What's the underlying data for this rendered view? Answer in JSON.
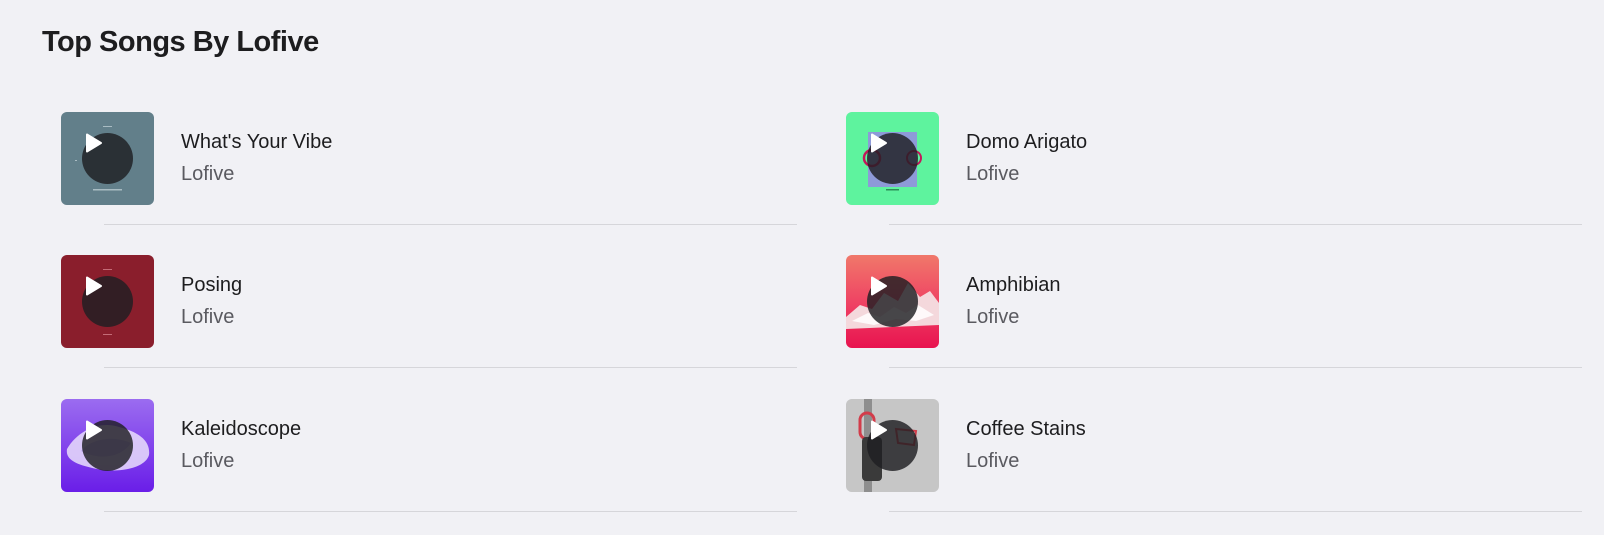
{
  "section": {
    "title": "Top Songs By Lofive"
  },
  "songs": [
    {
      "title": "What's Your Vibe",
      "artist": "Lofive",
      "artwork_color": "#627f8a"
    },
    {
      "title": "Domo Arigato",
      "artist": "Lofive",
      "artwork_color": "#5ef39e"
    },
    {
      "title": "Posing",
      "artist": "Lofive",
      "artwork_color": "#8a1e2c"
    },
    {
      "title": "Amphibian",
      "artist": "Lofive",
      "artwork_color": "#e8134f"
    },
    {
      "title": "Kaleidoscope",
      "artist": "Lofive",
      "artwork_color": "#7a2fe8"
    },
    {
      "title": "Coffee Stains",
      "artist": "Lofive",
      "artwork_color": "#bfbfbf"
    }
  ],
  "icons": {
    "play": "play-icon"
  }
}
